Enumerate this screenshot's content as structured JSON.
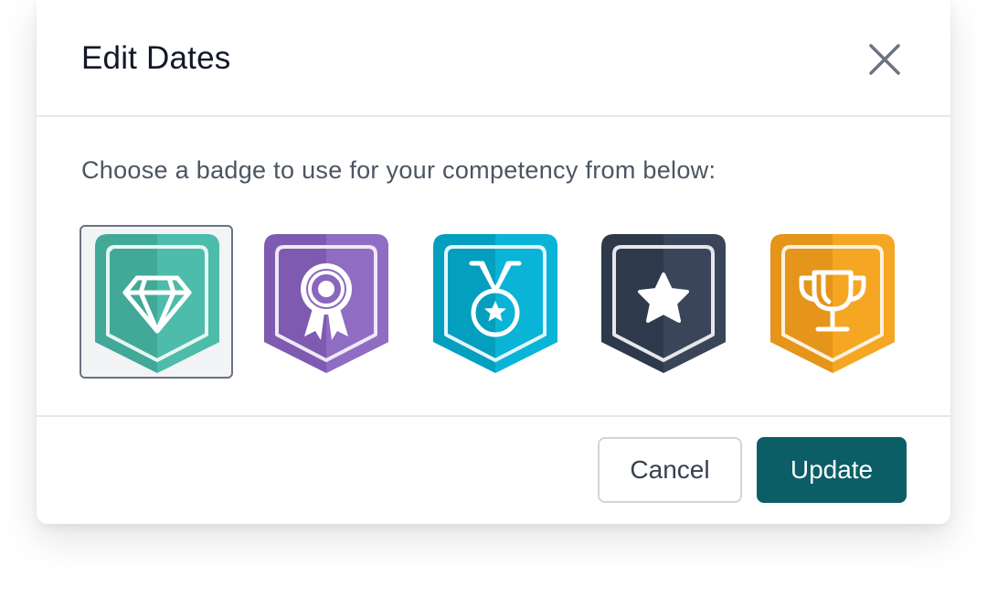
{
  "modal": {
    "title": "Edit Dates",
    "close_icon": "close-icon",
    "prompt": "Choose a badge to use for your competency from below:"
  },
  "badges": [
    {
      "id": "diamond",
      "icon": "diamond-icon",
      "color": "#4ab3a2",
      "selected": true
    },
    {
      "id": "rosette",
      "icon": "rosette-icon",
      "color": "#8c68bd",
      "selected": false
    },
    {
      "id": "medal",
      "icon": "medal-icon",
      "color": "#0aaed0",
      "selected": false
    },
    {
      "id": "star",
      "icon": "star-icon",
      "color": "#364156",
      "selected": false
    },
    {
      "id": "trophy",
      "icon": "trophy-icon",
      "color": "#f2a21f",
      "selected": false
    }
  ],
  "footer": {
    "cancel_label": "Cancel",
    "update_label": "Update"
  },
  "colors": {
    "primary": "#0b5e66",
    "title_text": "#111827",
    "body_text": "#4b5563"
  }
}
